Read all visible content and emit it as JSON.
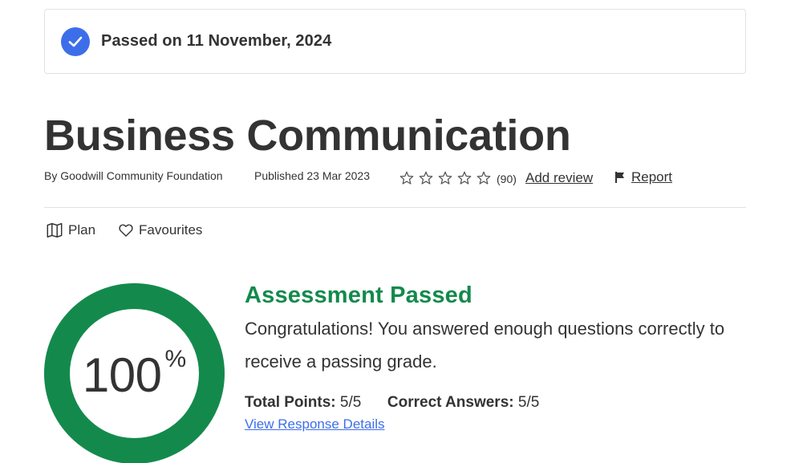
{
  "banner": {
    "icon": "check-circle-icon",
    "text": "Passed on 11 November, 2024"
  },
  "course": {
    "title": "Business Communication",
    "author": "By Goodwill Community Foundation",
    "published": "Published 23 Mar 2023",
    "rating": {
      "stars_filled": 0,
      "stars_total": 5,
      "count": "(90)"
    },
    "add_review_label": "Add review",
    "report_label": "Report"
  },
  "actions": {
    "plan_label": "Plan",
    "favourites_label": "Favourites"
  },
  "result": {
    "score_value": "100",
    "score_unit": "%",
    "score_fraction": 1.0,
    "title": "Assessment Passed",
    "message": "Congratulations! You answered enough questions correctly to receive a passing grade.",
    "total_points_label": "Total Points:",
    "total_points_value": "5/5",
    "correct_answers_label": "Correct Answers:",
    "correct_answers_value": "5/5",
    "details_link": "View Response Details"
  },
  "colors": {
    "accent_blue": "#3d6eea",
    "success_green": "#138a4c",
    "text": "#333333"
  }
}
